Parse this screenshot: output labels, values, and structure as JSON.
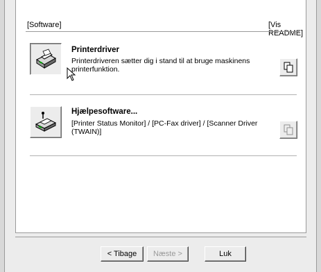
{
  "header": {
    "left": "[Software]",
    "right": "[Vis README]"
  },
  "items": [
    {
      "title": "Printerdriver",
      "description": "Printerdriveren sætter dig i stand til at bruge maskinens printerfunktion."
    },
    {
      "title": "Hjælpesoftware...",
      "description": "[Printer Status Monitor] / [PC-Fax driver] / [Scanner Driver (TWAIN)]"
    }
  ],
  "buttons": {
    "back": "< Tibage",
    "next": "Næste >",
    "close": "Luk"
  }
}
